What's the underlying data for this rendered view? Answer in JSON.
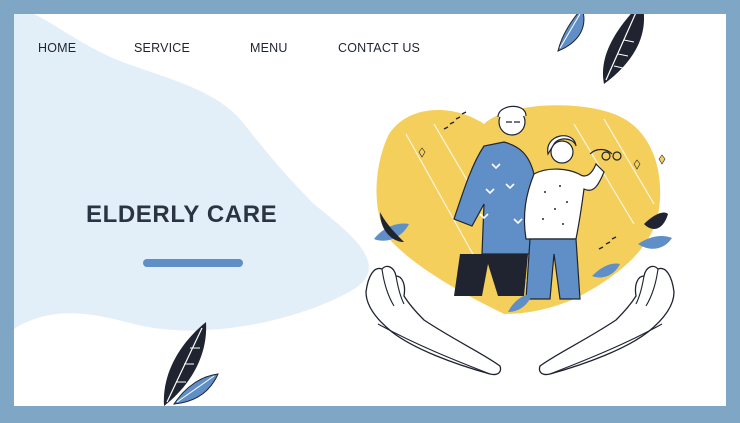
{
  "nav": {
    "items": [
      {
        "label": "HOME"
      },
      {
        "label": "SERVICE"
      },
      {
        "label": "MENU"
      },
      {
        "label": "CONTACT US"
      }
    ]
  },
  "hero": {
    "title": "ELDERLY CARE"
  },
  "colors": {
    "frame": "#7fa6c5",
    "wave": "#e3eff8",
    "accent_blue": "#5f8fc6",
    "heart_yellow": "#f5cf5b",
    "ink": "#1f2430"
  },
  "icons": [
    "leaf-icon",
    "heart-icon",
    "hands-icon"
  ]
}
